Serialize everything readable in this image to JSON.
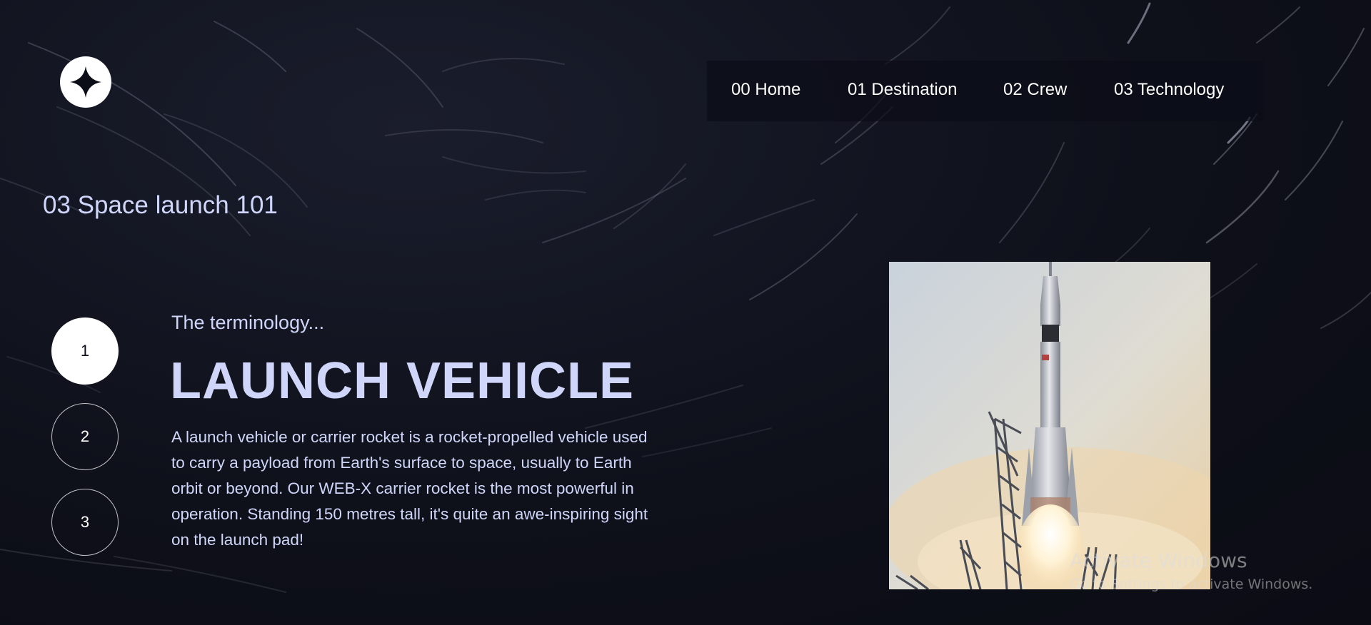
{
  "nav": {
    "items": [
      {
        "number": "00",
        "label": "Home"
      },
      {
        "number": "01",
        "label": "Destination"
      },
      {
        "number": "02",
        "label": "Crew"
      },
      {
        "number": "03",
        "label": "Technology"
      }
    ],
    "item_texts": [
      "00 Home",
      "01 Destination",
      "02 Crew",
      "03 Technology"
    ]
  },
  "page": {
    "title": "03 Space launch 101"
  },
  "steps": [
    {
      "label": "1",
      "active": true
    },
    {
      "label": "2",
      "active": false
    },
    {
      "label": "3",
      "active": false
    }
  ],
  "content": {
    "eyebrow": "The terminology...",
    "heading": "LAUNCH VEHICLE",
    "body": "A launch vehicle or carrier rocket is a rocket-propelled vehicle used to carry a payload from Earth's surface to space, usually to Earth orbit or beyond. Our WEB-X carrier rocket is the most powerful in operation. Standing 150 metres tall, it's quite an awe-inspiring sight on the launch pad!"
  },
  "image": {
    "subject": "rocket-launch-photo"
  },
  "os_watermark": {
    "title": "Activate Windows",
    "subtitle": "Go to Settings to activate Windows."
  },
  "colors": {
    "background": "#0b0d17",
    "accent_text": "#d0d6f9",
    "white": "#ffffff"
  },
  "icons": {
    "logo": "four-point-star-icon"
  }
}
